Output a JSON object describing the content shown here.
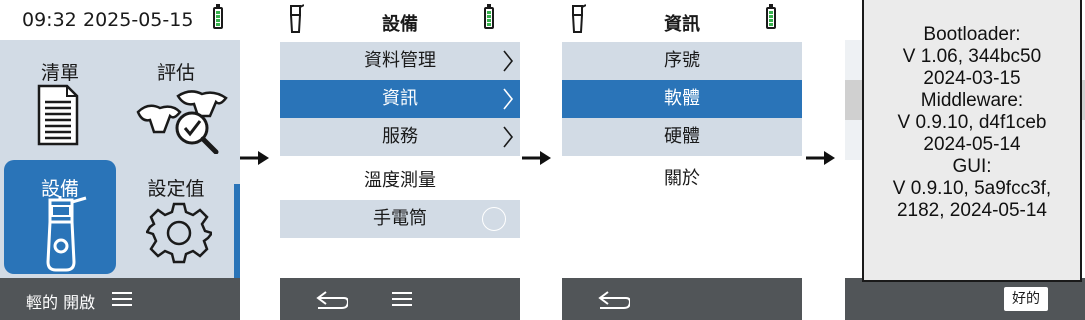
{
  "screen1": {
    "time": "09:32",
    "date": "2025-05-15",
    "tiles": [
      {
        "label": "清單",
        "icon": "list-document-icon"
      },
      {
        "label": "評估",
        "icon": "cows-checkmark-icon"
      },
      {
        "label": "設備",
        "icon": "device-icon"
      },
      {
        "label": "設定值",
        "icon": "gear-icon"
      }
    ],
    "bottom_label": "輕的 開啟",
    "bottom_icon": "hamburger-menu-icon"
  },
  "screen2": {
    "title": "設備",
    "items": [
      {
        "label": "資料管理",
        "state": "normal",
        "chevron": true
      },
      {
        "label": "資訊",
        "state": "selected",
        "chevron": true
      },
      {
        "label": "服務",
        "state": "normal",
        "chevron": true
      },
      {
        "label": "溫度測量",
        "state": "plain",
        "chevron": false
      },
      {
        "label": "手電筒",
        "state": "normal",
        "chevron": false,
        "toggle": "off"
      }
    ],
    "bottom_icons": [
      "back-arrow-icon",
      "hamburger-menu-icon"
    ]
  },
  "screen3": {
    "title": "資訊",
    "items": [
      {
        "label": "序號",
        "state": "normal"
      },
      {
        "label": "軟體",
        "state": "selected"
      },
      {
        "label": "硬體",
        "state": "normal"
      },
      {
        "label": "關於",
        "state": "plain"
      }
    ],
    "bottom_icons": [
      "back-arrow-icon"
    ]
  },
  "screen4": {
    "dialog_lines": [
      "Bootloader:",
      "V 1.06, 344bc50",
      "2024-03-15",
      "Middleware:",
      "V 0.9.10, d4f1ceb",
      "2024-05-14",
      "GUI:",
      "V 0.9.10, 5a9fcc3f,",
      "2182, 2024-05-14"
    ],
    "ok_button": "好的"
  },
  "colors": {
    "accent": "#2a74b8",
    "menu_grey": "#d2dbe5",
    "bottombar": "#515558",
    "battery_green": "#37b24d"
  }
}
